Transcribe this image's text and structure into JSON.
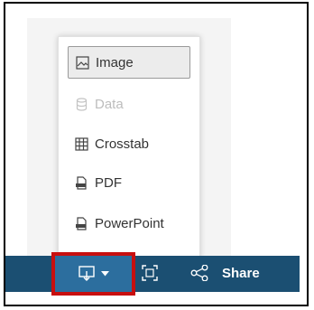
{
  "menu": {
    "items": [
      {
        "label": "Image",
        "icon": "image-icon",
        "state": "selected"
      },
      {
        "label": "Data",
        "icon": "database-icon",
        "state": "disabled"
      },
      {
        "label": "Crosstab",
        "icon": "table-icon",
        "state": "normal"
      },
      {
        "label": "PDF",
        "icon": "pdf-file-icon",
        "state": "normal"
      },
      {
        "label": "PowerPoint",
        "icon": "powerpoint-file-icon",
        "state": "normal"
      }
    ]
  },
  "toolbar": {
    "download_icon": "download-icon",
    "fullscreen_icon": "fullscreen-icon",
    "share_icon": "share-icon",
    "share_label": "Share"
  },
  "colors": {
    "toolbar_bg": "#1b4f72",
    "highlight_border": "#c80f0f",
    "disabled_text": "#bdbdbd"
  }
}
